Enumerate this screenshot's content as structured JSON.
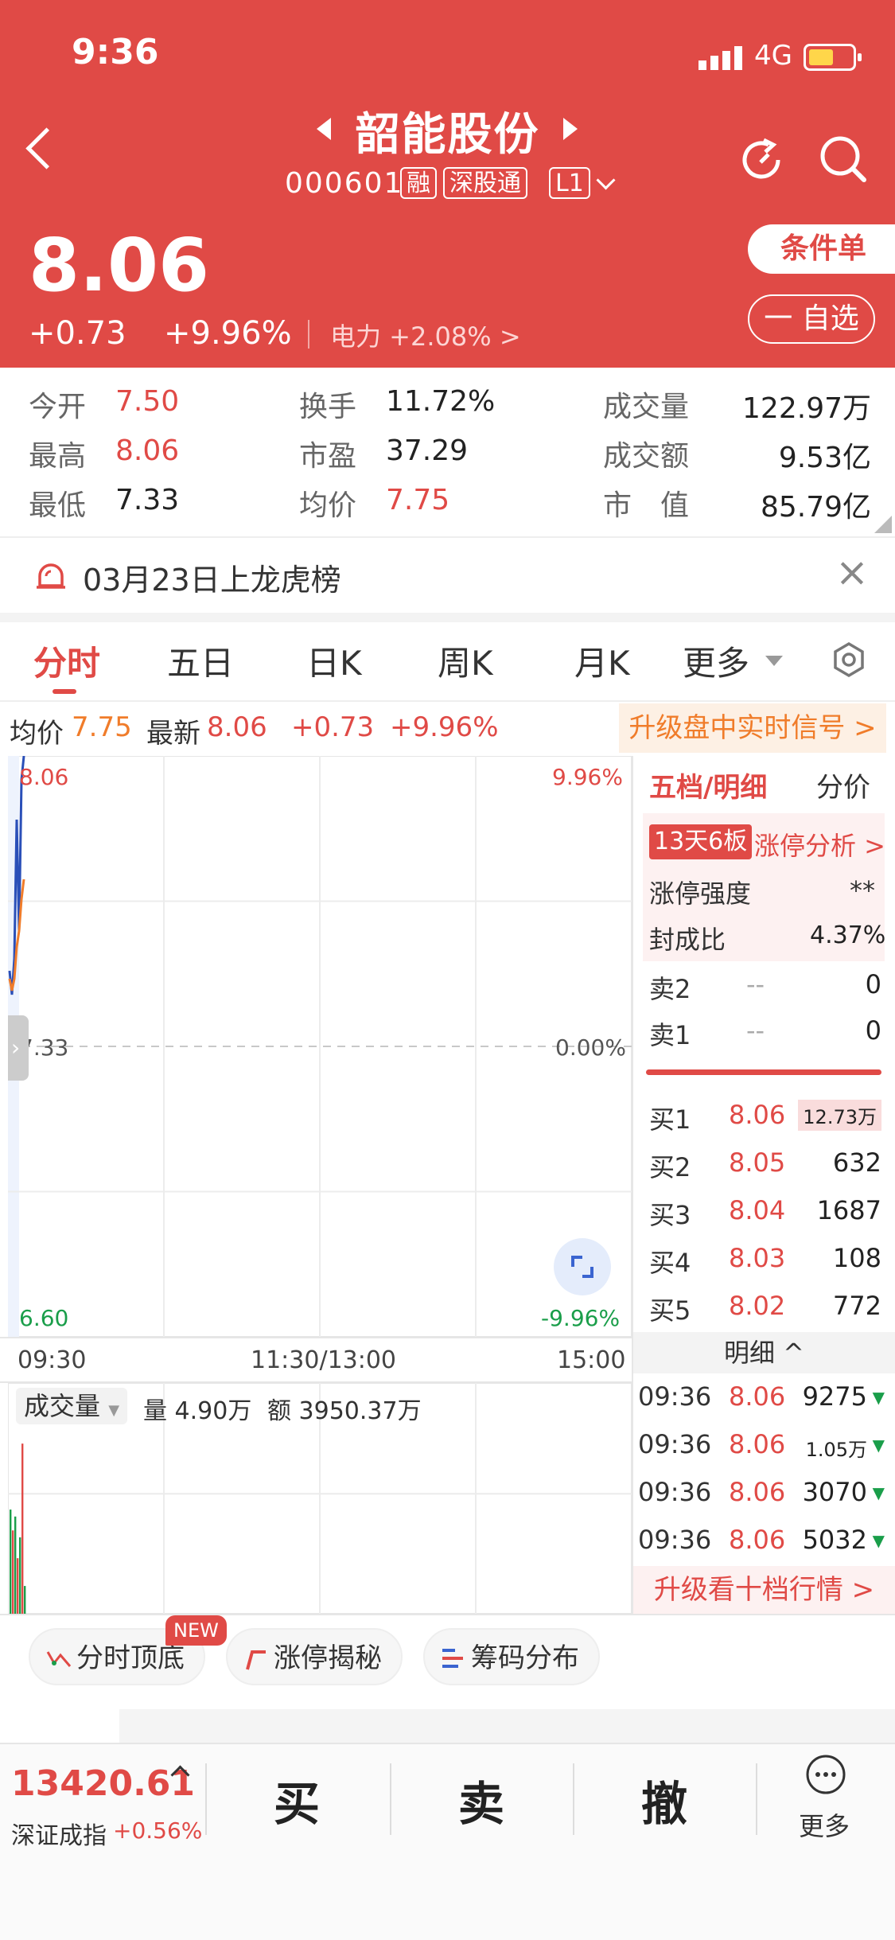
{
  "status_bar": {
    "time": "9:36",
    "network": "4G"
  },
  "header": {
    "title": "韶能股份",
    "code": "000601",
    "tags": [
      "融",
      "深股通",
      "L1"
    ],
    "price": "8.06",
    "change": "+0.73",
    "change_pct": "+9.96%",
    "sector": "电力 +2.08%",
    "sector_arrow": ">",
    "condition_order": "条件单",
    "watchlist": "一 自选",
    "colors": {
      "bg": "#e04a46",
      "up": "#e04a46",
      "down": "#1a9e4a"
    }
  },
  "stats": [
    {
      "label": "今开",
      "value": "7.50",
      "color": "red"
    },
    {
      "label": "换手",
      "value": "11.72%",
      "color": "black"
    },
    {
      "label": "成交量",
      "value": "122.97万",
      "color": "black"
    },
    {
      "label": "最高",
      "value": "8.06",
      "color": "red"
    },
    {
      "label": "市盈",
      "value": "37.29",
      "color": "black"
    },
    {
      "label": "成交额",
      "value": "9.53亿",
      "color": "black"
    },
    {
      "label": "最低",
      "value": "7.33",
      "color": "black"
    },
    {
      "label": "均价",
      "value": "7.75",
      "color": "red"
    },
    {
      "label": "市　值",
      "value": "85.79亿",
      "color": "black"
    }
  ],
  "notice": {
    "text": "03月23日上龙虎榜",
    "close": "×"
  },
  "tabs": [
    "分时",
    "五日",
    "日K",
    "周K",
    "月K",
    "更多"
  ],
  "info_bar": {
    "avg_label": "均价",
    "avg_value": "7.75",
    "latest_label": "最新",
    "latest_value": "8.06",
    "change": "+0.73",
    "change_pct": "+9.96%",
    "promo": "升级盘中实时信号 >"
  },
  "chart_data": {
    "type": "line",
    "y_labels_left": {
      "top": "8.06",
      "mid": "7.33",
      "bottom": "6.60"
    },
    "y_labels_right": {
      "top": "9.96%",
      "mid": "0.00%",
      "bottom": "-9.96%"
    },
    "x_labels": [
      "09:30",
      "11:30/13:00",
      "15:00"
    ],
    "ylim": [
      6.6,
      8.06
    ],
    "series": [
      {
        "color": "#2a4fb8",
        "x": [
          0,
          1,
          2,
          3,
          4,
          5,
          6
        ],
        "values": [
          7.52,
          7.46,
          7.55,
          7.9,
          7.62,
          8.0,
          8.06
        ]
      },
      {
        "color": "#f07c2a",
        "x": [
          0,
          1,
          2,
          3,
          4,
          5,
          6
        ],
        "values": [
          7.5,
          7.47,
          7.5,
          7.58,
          7.62,
          7.7,
          7.75
        ]
      }
    ],
    "volume_label": "成交量",
    "volume_amount": "量 4.90万",
    "volume_value": "额 3950.37万",
    "volume_bars": [
      {
        "value": 3.0,
        "color": "#1a9e4a"
      },
      {
        "value": 2.4,
        "color": "#e04a46"
      },
      {
        "value": 2.8,
        "color": "#1a9e4a"
      },
      {
        "value": 1.6,
        "color": "#e04a46"
      },
      {
        "value": 2.2,
        "color": "#1a9e4a"
      },
      {
        "value": 4.9,
        "color": "#e04a46"
      },
      {
        "value": 0.8,
        "color": "#1a9e4a"
      }
    ],
    "volume_max": 5.5
  },
  "orderbook": {
    "tab1": "五档/明细",
    "tab2": "分价",
    "limit_badge": "13天6板",
    "limit_analysis": "涨停分析 >",
    "strength_label": "涨停强度",
    "strength_value": "**",
    "seal_label": "封成比",
    "seal_value": "4.37%",
    "sells": [
      {
        "label": "卖2",
        "price": "--",
        "vol": "0"
      },
      {
        "label": "卖1",
        "price": "--",
        "vol": "0"
      }
    ],
    "buys": [
      {
        "label": "买1",
        "price": "8.06",
        "vol": "12.73万"
      },
      {
        "label": "买2",
        "price": "8.05",
        "vol": "632"
      },
      {
        "label": "买3",
        "price": "8.04",
        "vol": "1687"
      },
      {
        "label": "买4",
        "price": "8.03",
        "vol": "108"
      },
      {
        "label": "买5",
        "price": "8.02",
        "vol": "772"
      }
    ],
    "detail_label": "明细 ^",
    "ticks": [
      {
        "time": "09:36",
        "price": "8.06",
        "vol": "9275"
      },
      {
        "time": "09:36",
        "price": "8.06",
        "vol": "1.05万"
      },
      {
        "time": "09:36",
        "price": "8.06",
        "vol": "3070"
      },
      {
        "time": "09:36",
        "price": "8.06",
        "vol": "5032"
      }
    ],
    "upgrade": "升级看十档行情 >"
  },
  "chips": [
    "分时顶底",
    "涨停揭秘",
    "筹码分布"
  ],
  "new_badge": "NEW",
  "bottom": {
    "index_value": "13420.61",
    "index_name": "深证成指",
    "index_change": "+0.56%",
    "buy": "买",
    "sell": "卖",
    "cancel": "撤",
    "more": "更多"
  }
}
